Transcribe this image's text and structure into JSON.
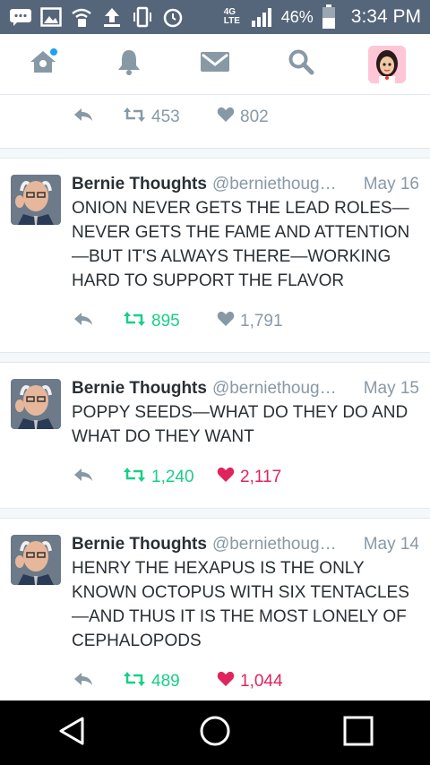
{
  "status_bar": {
    "network": "4G LTE",
    "battery": "46%",
    "time": "3:34 PM"
  },
  "nav": {
    "items": [
      "home-icon",
      "bell-icon",
      "mail-icon",
      "search-icon",
      "avatar"
    ]
  },
  "top_actions": {
    "retweets": "453",
    "likes": "802"
  },
  "tweets": [
    {
      "name": "Bernie Thoughts",
      "handle": "@berniethoug…",
      "date": "May 16",
      "text": "ONION NEVER GETS THE LEAD ROLES—NEVER GETS THE FAME AND ATTENTION—BUT IT'S ALWAYS THERE—WORKING HARD TO SUPPORT THE FLAVOR",
      "retweets": "895",
      "likes": "1,791"
    },
    {
      "name": "Bernie Thoughts",
      "handle": "@berniethoug…",
      "date": "May 15",
      "text": "POPPY SEEDS—WHAT DO THEY DO AND WHAT DO THEY WANT",
      "retweets": "1,240",
      "likes": "2,117"
    },
    {
      "name": "Bernie Thoughts",
      "handle": "@berniethoug…",
      "date": "May 14",
      "text": "HENRY THE HEXAPUS IS THE ONLY KNOWN OCTOPUS WITH SIX TENTACLES—AND THUS IT IS THE MOST LONELY OF CEPHALOPODS",
      "retweets": "489",
      "likes": "1,044"
    }
  ],
  "colors": {
    "retweet_active": "#19cf86",
    "like_active": "#e0245e",
    "muted": "#8899a6",
    "status_bar": "#55667a"
  }
}
